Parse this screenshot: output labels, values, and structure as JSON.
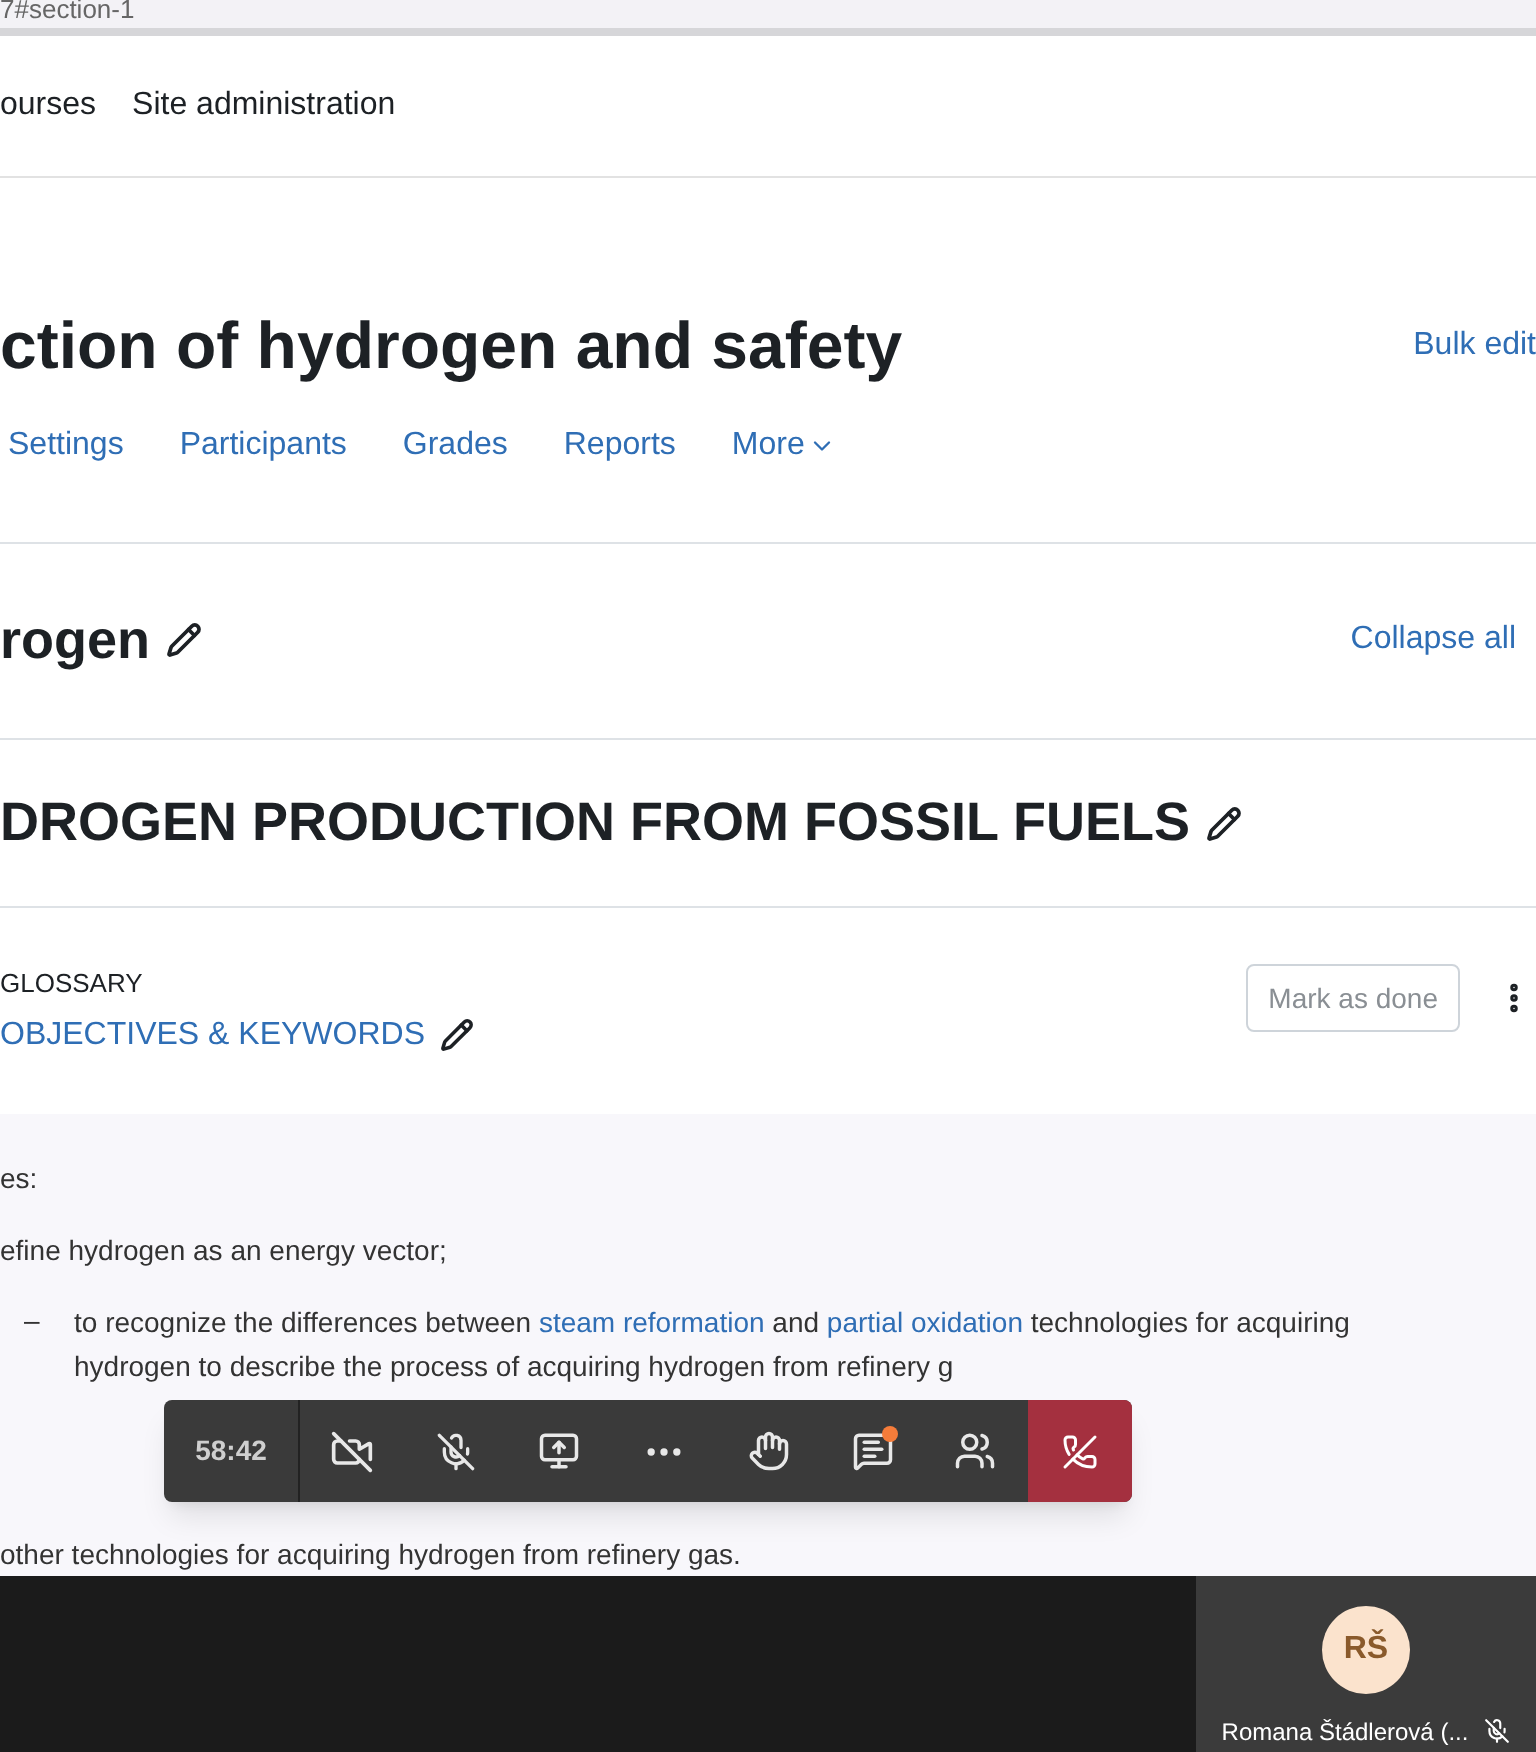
{
  "address_bar": {
    "url": "7#section-1"
  },
  "top_nav": [
    {
      "label": "ourses"
    },
    {
      "label": "Site administration"
    }
  ],
  "course": {
    "title": "ction of hydrogen and safety",
    "action": "Bulk edit"
  },
  "course_tabs": [
    {
      "label": "Settings",
      "has_menu": false
    },
    {
      "label": "Participants",
      "has_menu": false
    },
    {
      "label": "Grades",
      "has_menu": false
    },
    {
      "label": "Reports",
      "has_menu": false
    },
    {
      "label": "More",
      "has_menu": true
    }
  ],
  "section": {
    "title": "rogen",
    "action": "Collapse all"
  },
  "subsection": {
    "title": "DROGEN PRODUCTION FROM FOSSIL FUELS"
  },
  "activity": {
    "type": "GLOSSARY",
    "title": "OBJECTIVES & KEYWORDS",
    "button": "Mark as done"
  },
  "content": {
    "intro": "es:",
    "items": [
      {
        "marker": "",
        "parts": [
          {
            "text": "efine hydrogen as an energy vector;",
            "link": false
          }
        ]
      },
      {
        "marker": "–",
        "parts": [
          {
            "text": "to recognize the differences between ",
            "link": false
          },
          {
            "text": "steam reformation",
            "link": true
          },
          {
            "text": " and ",
            "link": false
          },
          {
            "text": "partial oxidation",
            "link": true
          },
          {
            "text": " technologies for acquiring hydrogen to describe the process of acquiring hydrogen from refinery g",
            "link": false
          }
        ]
      },
      {
        "marker": "",
        "parts": [
          {
            "text": "other technologies for acquiring hydrogen from refinery gas.",
            "link": false
          }
        ]
      }
    ]
  },
  "call_toolbar": {
    "timer": "58:42",
    "chat_unread": true
  },
  "participant": {
    "initials": "RŠ",
    "name": "Romana Štádlerová (...",
    "muted": true
  }
}
